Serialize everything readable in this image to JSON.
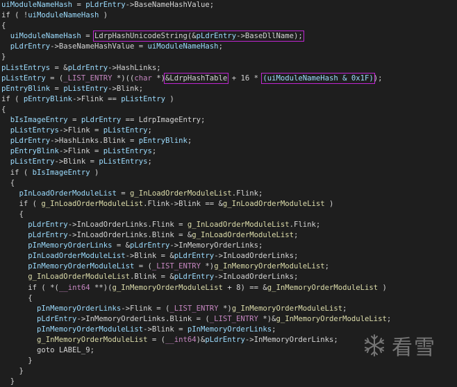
{
  "editor": {
    "lines": [
      {
        "indent": 0,
        "tokens": [
          {
            "t": "uiModuleNameHash",
            "c": "ident"
          },
          {
            "t": " = ",
            "c": "op"
          },
          {
            "t": "pLdrEntry",
            "c": "ident"
          },
          {
            "t": "->BaseNameHashValue;",
            "c": "plain"
          }
        ]
      },
      {
        "indent": 0,
        "tokens": [
          {
            "t": "if ( !",
            "c": "kw"
          },
          {
            "t": "uiModuleNameHash",
            "c": "ident"
          },
          {
            "t": " )",
            "c": "plain"
          }
        ]
      },
      {
        "indent": 0,
        "tokens": [
          {
            "t": "{",
            "c": "plain"
          }
        ]
      },
      {
        "indent": 2,
        "tokens": [
          {
            "t": "uiModuleNameHash",
            "c": "ident"
          },
          {
            "t": " = ",
            "c": "op"
          },
          {
            "t": "LdrpHashUnicodeString(&",
            "c": "plain",
            "box": "open"
          },
          {
            "t": "pLdrEntry",
            "c": "ident"
          },
          {
            "t": "->BaseDllName);",
            "c": "plain",
            "box": "close"
          }
        ]
      },
      {
        "indent": 2,
        "tokens": [
          {
            "t": "pLdrEntry",
            "c": "ident"
          },
          {
            "t": "->BaseNameHashValue = ",
            "c": "plain"
          },
          {
            "t": "uiModuleNameHash",
            "c": "ident"
          },
          {
            "t": ";",
            "c": "plain"
          }
        ]
      },
      {
        "indent": 0,
        "tokens": [
          {
            "t": "}",
            "c": "plain"
          }
        ]
      },
      {
        "indent": 0,
        "tokens": [
          {
            "t": "pListEntrys",
            "c": "ident"
          },
          {
            "t": " = &",
            "c": "op"
          },
          {
            "t": "pLdrEntry",
            "c": "ident"
          },
          {
            "t": "->HashLinks;",
            "c": "plain"
          }
        ]
      },
      {
        "indent": 0,
        "tokens": [
          {
            "t": "pListEntry",
            "c": "ident"
          },
          {
            "t": " = (",
            "c": "op"
          },
          {
            "t": "_LIST_ENTRY",
            "c": "type"
          },
          {
            "t": " *)((",
            "c": "plain"
          },
          {
            "t": "char",
            "c": "type"
          },
          {
            "t": " *)",
            "c": "plain"
          },
          {
            "t": "&LdrpHashTable",
            "c": "plain",
            "box": "single"
          },
          {
            "t": " + 16 * ",
            "c": "plain"
          },
          {
            "t": "(uiModuleNameHash & 0x1F)",
            "c": "ident",
            "box": "single"
          },
          {
            "t": ");",
            "c": "plain"
          }
        ]
      },
      {
        "indent": 0,
        "tokens": [
          {
            "t": "pEntryBlink",
            "c": "ident"
          },
          {
            "t": " = ",
            "c": "op"
          },
          {
            "t": "pListEntry",
            "c": "ident"
          },
          {
            "t": "->Blink;",
            "c": "plain"
          }
        ]
      },
      {
        "indent": 0,
        "tokens": [
          {
            "t": "if ( ",
            "c": "kw"
          },
          {
            "t": "pEntryBlink",
            "c": "ident"
          },
          {
            "t": "->Flink == ",
            "c": "plain"
          },
          {
            "t": "pListEntry",
            "c": "ident"
          },
          {
            "t": " )",
            "c": "plain"
          }
        ]
      },
      {
        "indent": 0,
        "tokens": [
          {
            "t": "{",
            "c": "plain"
          }
        ]
      },
      {
        "indent": 2,
        "tokens": [
          {
            "t": "bIsImageEntry",
            "c": "ident"
          },
          {
            "t": " = ",
            "c": "op"
          },
          {
            "t": "pLdrEntry",
            "c": "ident"
          },
          {
            "t": " == LdrpImageEntry;",
            "c": "plain"
          }
        ]
      },
      {
        "indent": 2,
        "tokens": [
          {
            "t": "pListEntrys",
            "c": "ident"
          },
          {
            "t": "->Flink = ",
            "c": "plain"
          },
          {
            "t": "pListEntry",
            "c": "ident"
          },
          {
            "t": ";",
            "c": "plain"
          }
        ]
      },
      {
        "indent": 2,
        "tokens": [
          {
            "t": "pLdrEntry",
            "c": "ident"
          },
          {
            "t": "->HashLinks.Blink = ",
            "c": "plain"
          },
          {
            "t": "pEntryBlink",
            "c": "ident"
          },
          {
            "t": ";",
            "c": "plain"
          }
        ]
      },
      {
        "indent": 2,
        "tokens": [
          {
            "t": "pEntryBlink",
            "c": "ident"
          },
          {
            "t": "->Flink = ",
            "c": "plain"
          },
          {
            "t": "pListEntrys",
            "c": "ident"
          },
          {
            "t": ";",
            "c": "plain"
          }
        ]
      },
      {
        "indent": 2,
        "tokens": [
          {
            "t": "pListEntry",
            "c": "ident"
          },
          {
            "t": "->Blink = ",
            "c": "plain"
          },
          {
            "t": "pListEntrys",
            "c": "ident"
          },
          {
            "t": ";",
            "c": "plain"
          }
        ]
      },
      {
        "indent": 2,
        "tokens": [
          {
            "t": "if ( ",
            "c": "kw"
          },
          {
            "t": "bIsImageEntry",
            "c": "ident"
          },
          {
            "t": " )",
            "c": "plain"
          }
        ]
      },
      {
        "indent": 2,
        "tokens": [
          {
            "t": "{",
            "c": "plain"
          }
        ]
      },
      {
        "indent": 4,
        "tokens": [
          {
            "t": "pInLoadOrderModuleList",
            "c": "ident"
          },
          {
            "t": " = ",
            "c": "op"
          },
          {
            "t": "g_InLoadOrderModuleList",
            "c": "global"
          },
          {
            "t": ".Flink;",
            "c": "plain"
          }
        ]
      },
      {
        "indent": 4,
        "tokens": [
          {
            "t": "if ( ",
            "c": "kw"
          },
          {
            "t": "g_InLoadOrderModuleList",
            "c": "global"
          },
          {
            "t": ".Flink->Blink == &",
            "c": "plain"
          },
          {
            "t": "g_InLoadOrderModuleList",
            "c": "global"
          },
          {
            "t": " )",
            "c": "plain"
          }
        ]
      },
      {
        "indent": 4,
        "tokens": [
          {
            "t": "{",
            "c": "plain"
          }
        ]
      },
      {
        "indent": 6,
        "tokens": [
          {
            "t": "pLdrEntry",
            "c": "ident"
          },
          {
            "t": "->InLoadOrderLinks.Flink = ",
            "c": "plain"
          },
          {
            "t": "g_InLoadOrderModuleList",
            "c": "global"
          },
          {
            "t": ".Flink;",
            "c": "plain"
          }
        ]
      },
      {
        "indent": 6,
        "tokens": [
          {
            "t": "pLdrEntry",
            "c": "ident"
          },
          {
            "t": "->InLoadOrderLinks.Blink = &",
            "c": "plain"
          },
          {
            "t": "g_InLoadOrderModuleList",
            "c": "global"
          },
          {
            "t": ";",
            "c": "plain"
          }
        ]
      },
      {
        "indent": 6,
        "tokens": [
          {
            "t": "pInMemoryOrderLinks",
            "c": "ident"
          },
          {
            "t": " = &",
            "c": "op"
          },
          {
            "t": "pLdrEntry",
            "c": "ident"
          },
          {
            "t": "->InMemoryOrderLinks;",
            "c": "plain"
          }
        ]
      },
      {
        "indent": 6,
        "tokens": [
          {
            "t": "pInLoadOrderModuleList",
            "c": "ident"
          },
          {
            "t": "->Blink = &",
            "c": "plain"
          },
          {
            "t": "pLdrEntry",
            "c": "ident"
          },
          {
            "t": "->InLoadOrderLinks;",
            "c": "plain"
          }
        ]
      },
      {
        "indent": 6,
        "tokens": [
          {
            "t": "pInMemoryOrderModuleList",
            "c": "ident"
          },
          {
            "t": " = (",
            "c": "op"
          },
          {
            "t": "_LIST_ENTRY",
            "c": "type"
          },
          {
            "t": " *)",
            "c": "plain"
          },
          {
            "t": "g_InMemoryOrderModuleList",
            "c": "global"
          },
          {
            "t": ";",
            "c": "plain"
          }
        ]
      },
      {
        "indent": 6,
        "tokens": [
          {
            "t": "g_InLoadOrderModuleList",
            "c": "global"
          },
          {
            "t": ".Blink = &",
            "c": "plain"
          },
          {
            "t": "pLdrEntry",
            "c": "ident"
          },
          {
            "t": "->InLoadOrderLinks;",
            "c": "plain"
          }
        ]
      },
      {
        "indent": 6,
        "tokens": [
          {
            "t": "if ( *(",
            "c": "kw"
          },
          {
            "t": "__int64",
            "c": "type"
          },
          {
            "t": " **)(",
            "c": "plain"
          },
          {
            "t": "g_InMemoryOrderModuleList",
            "c": "global"
          },
          {
            "t": " + 8) == &",
            "c": "plain"
          },
          {
            "t": "g_InMemoryOrderModuleList",
            "c": "global"
          },
          {
            "t": " )",
            "c": "plain"
          }
        ]
      },
      {
        "indent": 6,
        "tokens": [
          {
            "t": "{",
            "c": "plain"
          }
        ]
      },
      {
        "indent": 8,
        "tokens": [
          {
            "t": "pInMemoryOrderLinks",
            "c": "ident"
          },
          {
            "t": "->Flink = (",
            "c": "plain"
          },
          {
            "t": "_LIST_ENTRY",
            "c": "type"
          },
          {
            "t": " *)",
            "c": "plain"
          },
          {
            "t": "g_InMemoryOrderModuleList",
            "c": "global"
          },
          {
            "t": ";",
            "c": "plain"
          }
        ]
      },
      {
        "indent": 8,
        "tokens": [
          {
            "t": "pLdrEntry",
            "c": "ident"
          },
          {
            "t": "->InMemoryOrderLinks.Blink = (",
            "c": "plain"
          },
          {
            "t": "_LIST_ENTRY",
            "c": "type"
          },
          {
            "t": " *)&",
            "c": "plain"
          },
          {
            "t": "g_InMemoryOrderModuleList",
            "c": "global"
          },
          {
            "t": ";",
            "c": "plain"
          }
        ]
      },
      {
        "indent": 8,
        "tokens": [
          {
            "t": "pInMemoryOrderModuleList",
            "c": "ident"
          },
          {
            "t": "->Blink = ",
            "c": "plain"
          },
          {
            "t": "pInMemoryOrderLinks",
            "c": "ident"
          },
          {
            "t": ";",
            "c": "plain"
          }
        ]
      },
      {
        "indent": 8,
        "tokens": [
          {
            "t": "g_InMemoryOrderModuleList",
            "c": "global"
          },
          {
            "t": " = (",
            "c": "op"
          },
          {
            "t": "__int64",
            "c": "type"
          },
          {
            "t": ")&",
            "c": "plain"
          },
          {
            "t": "pLdrEntry",
            "c": "ident"
          },
          {
            "t": "->InMemoryOrderLinks;",
            "c": "plain"
          }
        ]
      },
      {
        "indent": 8,
        "tokens": [
          {
            "t": "goto LABEL_9;",
            "c": "plain"
          }
        ]
      },
      {
        "indent": 6,
        "tokens": [
          {
            "t": "}",
            "c": "plain"
          }
        ]
      },
      {
        "indent": 4,
        "tokens": [
          {
            "t": "}",
            "c": "plain"
          }
        ]
      },
      {
        "indent": 2,
        "tokens": [
          {
            "t": "}",
            "c": "plain"
          }
        ]
      }
    ]
  },
  "highlight_color": "#c026d3",
  "watermark": {
    "icon": "snowflake-icon",
    "text": "看雪"
  }
}
